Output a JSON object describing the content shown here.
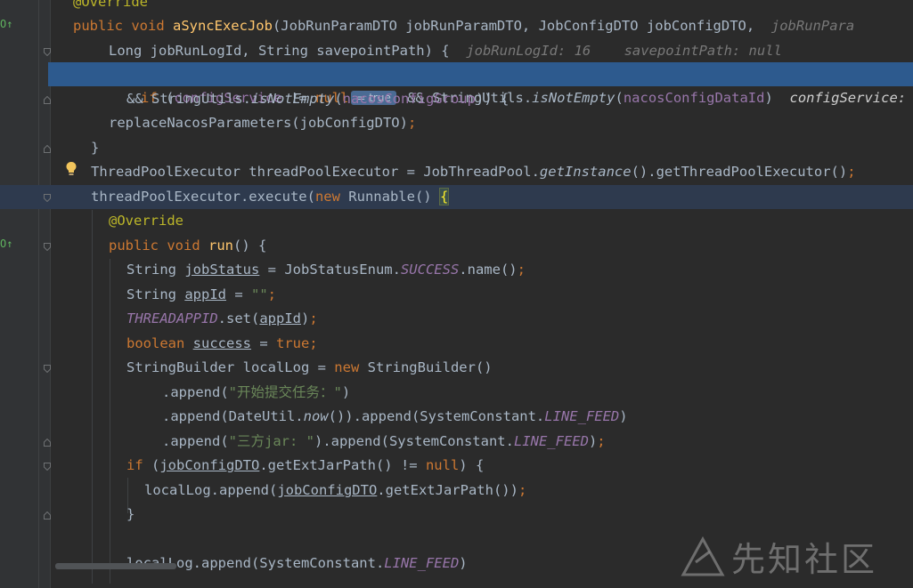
{
  "editor": {
    "lines": [
      {
        "id": "l0",
        "tokens": [
          [
            "ann",
            "@Override"
          ]
        ]
      },
      {
        "id": "l1",
        "tokens": [
          [
            "kw",
            "public void "
          ],
          [
            "fn",
            "aSyncExecJob"
          ],
          [
            "",
            "(JobRunParamDTO jobRunParamDTO, JobConfigDTO jobConfigDTO,  "
          ],
          [
            "hint",
            "jobRunPara"
          ]
        ]
      },
      {
        "id": "l2",
        "tokens": [
          [
            "",
            "Long jobRunLogId, String savepointPath) {  "
          ],
          [
            "hint",
            "jobRunLogId: 16    savepointPath: null"
          ]
        ]
      },
      {
        "id": "l3",
        "tokens": [
          [
            "kw",
            "if "
          ],
          [
            "",
            "("
          ],
          [
            "field",
            "configService "
          ],
          [
            "",
            "!= "
          ],
          [
            "kw",
            "null"
          ]
        ]
      },
      {
        "id": "l4",
        "tokens": [
          [
            "",
            "&& StringUtils."
          ],
          [
            "ital",
            "isNotEmpty"
          ],
          [
            "",
            "("
          ],
          [
            "field",
            "nacosConfigGroup"
          ],
          [
            "",
            ")) {"
          ]
        ]
      },
      {
        "id": "l5",
        "tokens": [
          [
            "",
            "replaceNacosParameters(jobConfigDTO)"
          ],
          [
            "kw",
            ";"
          ]
        ]
      },
      {
        "id": "l6",
        "tokens": [
          [
            "",
            "}"
          ]
        ]
      },
      {
        "id": "l7",
        "tokens": [
          [
            "",
            "ThreadPoolExecutor threadPoolExecutor = JobThreadPool."
          ],
          [
            "ital",
            "getInstance"
          ],
          [
            "",
            "().getThreadPoolExecutor()"
          ],
          [
            "kw",
            ";"
          ]
        ]
      },
      {
        "id": "l8",
        "tokens": [
          [
            "",
            "threadPoolExecutor.execute("
          ],
          [
            "kw",
            "new "
          ],
          [
            "",
            "Runnable() "
          ]
        ]
      },
      {
        "id": "l9",
        "tokens": [
          [
            "ann",
            "@Override"
          ]
        ]
      },
      {
        "id": "l10",
        "tokens": [
          [
            "kw",
            "public void "
          ],
          [
            "fn",
            "run"
          ],
          [
            "",
            "() {"
          ]
        ]
      },
      {
        "id": "l11",
        "tokens": [
          [
            "",
            "String "
          ],
          [
            "under",
            "jobStatus"
          ],
          [
            "",
            " = JobStatusEnum."
          ],
          [
            "static-i",
            "SUCCESS"
          ],
          [
            "",
            ".name()"
          ],
          [
            "kw",
            ";"
          ]
        ]
      },
      {
        "id": "l12",
        "tokens": [
          [
            "",
            "String "
          ],
          [
            "under",
            "appId"
          ],
          [
            "",
            " = "
          ],
          [
            "str",
            "\"\""
          ],
          [
            "kw",
            ";"
          ]
        ]
      },
      {
        "id": "l13",
        "tokens": [
          [
            "static-i",
            "THREADAPPID"
          ],
          [
            "",
            ".set("
          ],
          [
            "under",
            "appId"
          ],
          [
            "",
            ")"
          ],
          [
            "kw",
            ";"
          ]
        ]
      },
      {
        "id": "l14",
        "tokens": [
          [
            "kw",
            "boolean "
          ],
          [
            "under",
            "success"
          ],
          [
            "",
            " = "
          ],
          [
            "kw",
            "true;"
          ]
        ]
      },
      {
        "id": "l15",
        "tokens": [
          [
            "",
            "StringBuilder localLog = "
          ],
          [
            "kw",
            "new "
          ],
          [
            "",
            "StringBuilder()"
          ]
        ]
      },
      {
        "id": "l16",
        "tokens": [
          [
            "",
            ".append("
          ],
          [
            "str",
            "\"开始提交任务：\""
          ],
          [
            "",
            ")"
          ]
        ]
      },
      {
        "id": "l17",
        "tokens": [
          [
            "",
            ".append(DateUtil."
          ],
          [
            "ital",
            "now"
          ],
          [
            "",
            "()).append(SystemConstant."
          ],
          [
            "static-i",
            "LINE_FEED"
          ],
          [
            "",
            ")"
          ]
        ]
      },
      {
        "id": "l18",
        "tokens": [
          [
            "",
            ".append("
          ],
          [
            "str",
            "\"三方jar: \""
          ],
          [
            "",
            ").append(SystemConstant."
          ],
          [
            "static-i",
            "LINE_FEED"
          ],
          [
            "",
            ")"
          ],
          [
            "kw",
            ";"
          ]
        ]
      },
      {
        "id": "l19",
        "tokens": [
          [
            "kw",
            "if "
          ],
          [
            "",
            "("
          ],
          [
            "under",
            "jobConfigDTO"
          ],
          [
            "",
            ".getExtJarPath() != "
          ],
          [
            "kw",
            "null"
          ],
          [
            "",
            ") {"
          ]
        ]
      },
      {
        "id": "l20",
        "tokens": [
          [
            "",
            "localLog.append("
          ],
          [
            "under",
            "jobConfigDTO"
          ],
          [
            "",
            ".getExtJarPath())"
          ],
          [
            "kw",
            ";"
          ]
        ]
      },
      {
        "id": "l21",
        "tokens": [
          [
            "",
            "}"
          ]
        ]
      },
      {
        "id": "l22",
        "tokens": []
      },
      {
        "id": "l23",
        "tokens": [
          [
            "",
            "localLog.append(SystemConstant."
          ],
          [
            "static-i",
            "LINE_FEED"
          ],
          [
            "",
            ")"
          ]
        ]
      }
    ],
    "highlight_line": {
      "inlay_value": "= true",
      "after_inlay": "&& StringUtils.",
      "method": "isNotEmpty",
      "paren_open": "(",
      "arg": "nacosConfigDataId",
      "paren_close": ")",
      "hint": "configService:"
    },
    "brace": "{"
  },
  "gutter": {
    "override_marker": "O↑"
  },
  "watermark": {
    "text": "先知社区"
  }
}
